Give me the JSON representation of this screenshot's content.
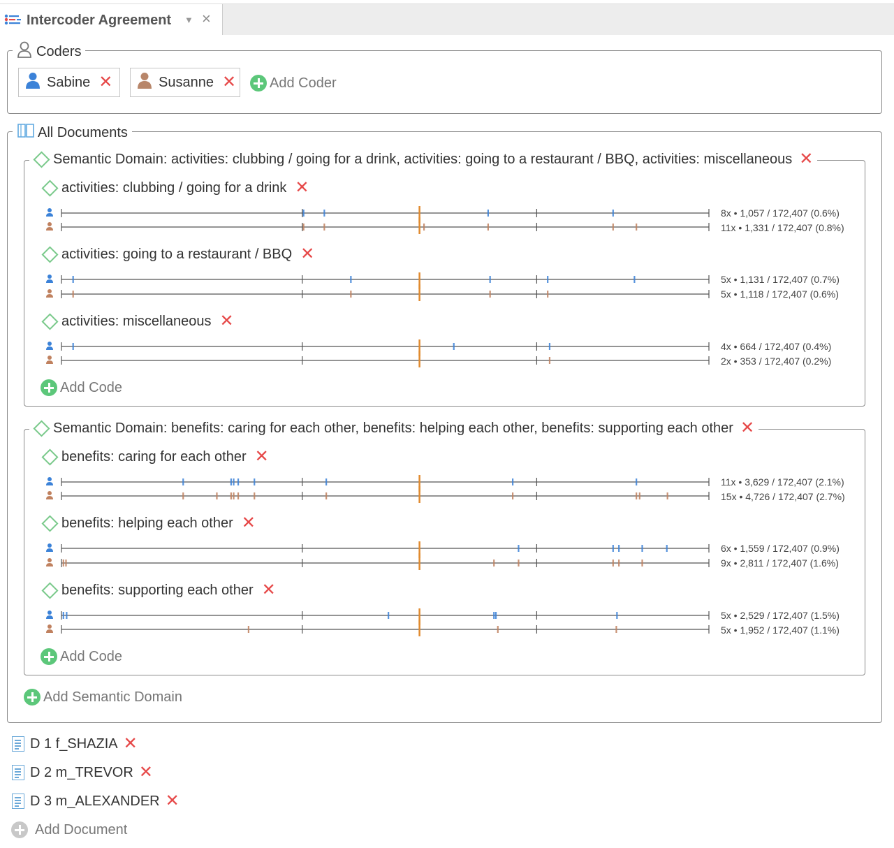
{
  "tab": {
    "title": "Intercoder Agreement",
    "dropdown_icon": "chevron-down-icon",
    "close_symbol": "×"
  },
  "colors": {
    "coder1": "#3b82d8",
    "coder2": "#c0815f",
    "remove": "#e64848",
    "add": "#5cc77a",
    "marker": "#e08a2e",
    "diamond": "#79c98a"
  },
  "coders": {
    "legend": "Coders",
    "items": [
      {
        "name": "Sabine",
        "color": "#3b82d8"
      },
      {
        "name": "Susanne",
        "color": "#b8866a"
      }
    ],
    "add_label": "Add Coder"
  },
  "documents_group": {
    "legend": "All Documents"
  },
  "domains": [
    {
      "title": "Semantic Domain: activities: clubbing / going for a drink, activities: going to a restaurant / BBQ, activities: miscellaneous",
      "codes": [
        {
          "name": "activities: clubbing / going for a drink",
          "rows": [
            {
              "coder": "Sabine",
              "stats": "8x • 1,057 / 172,407 (0.6%)",
              "segments": [
                0.374,
                0.406,
                0.659,
                0.852
              ]
            },
            {
              "coder": "Susanne",
              "stats": "11x • 1,331 / 172,407 (0.8%)",
              "segments": [
                0.374,
                0.406,
                0.56,
                0.659,
                0.852,
                0.888
              ]
            }
          ]
        },
        {
          "name": "activities: going to a restaurant / BBQ",
          "rows": [
            {
              "coder": "Sabine",
              "stats": "5x • 1,131 / 172,407 (0.7%)",
              "segments": [
                0.018,
                0.447,
                0.662,
                0.751,
                0.885
              ]
            },
            {
              "coder": "Susanne",
              "stats": "5x • 1,118 / 172,407 (0.6%)",
              "segments": [
                0.018,
                0.447,
                0.662,
                0.751
              ]
            }
          ]
        },
        {
          "name": "activities: miscellaneous",
          "rows": [
            {
              "coder": "Sabine",
              "stats": "4x • 664 / 172,407 (0.4%)",
              "segments": [
                0.018,
                0.606,
                0.754
              ]
            },
            {
              "coder": "Susanne",
              "stats": "2x • 353 / 172,407 (0.2%)",
              "segments": [
                0.754
              ]
            }
          ]
        }
      ],
      "add_code_label": "Add Code"
    },
    {
      "title": "Semantic Domain: benefits: caring for each other, benefits: helping each other, benefits: supporting each other",
      "codes": [
        {
          "name": "benefits: caring for each other",
          "rows": [
            {
              "coder": "Sabine",
              "stats": "11x • 3,629 / 172,407 (2.1%)",
              "segments": [
                0.188,
                0.262,
                0.266,
                0.273,
                0.298,
                0.409,
                0.697,
                0.888
              ]
            },
            {
              "coder": "Susanne",
              "stats": "15x • 4,726 / 172,407 (2.7%)",
              "segments": [
                0.188,
                0.24,
                0.262,
                0.266,
                0.273,
                0.298,
                0.409,
                0.697,
                0.888,
                0.893,
                0.936
              ]
            }
          ]
        },
        {
          "name": "benefits: helping each other",
          "rows": [
            {
              "coder": "Sabine",
              "stats": "6x • 1,559 / 172,407 (0.9%)",
              "segments": [
                0.706,
                0.852,
                0.861,
                0.897,
                0.935
              ]
            },
            {
              "coder": "Susanne",
              "stats": "9x • 2,811 / 172,407 (1.6%)",
              "segments": [
                0.003,
                0.007,
                0.668,
                0.706,
                0.852,
                0.861,
                0.897
              ]
            }
          ]
        },
        {
          "name": "benefits: supporting each other",
          "rows": [
            {
              "coder": "Sabine",
              "stats": "5x • 2,529 / 172,407 (1.5%)",
              "segments": [
                0.003,
                0.008,
                0.505,
                0.668,
                0.671,
                0.858
              ]
            },
            {
              "coder": "Susanne",
              "stats": "5x • 1,952 / 172,407 (1.1%)",
              "segments": [
                0.289,
                0.674,
                0.857
              ]
            }
          ]
        }
      ],
      "add_code_label": "Add Code"
    }
  ],
  "add_domain_label": "Add Semantic Domain",
  "documents": [
    {
      "name": "D 1 f_SHAZIA"
    },
    {
      "name": "D 2 m_TREVOR"
    },
    {
      "name": "D 3 m_ALEXANDER"
    }
  ],
  "add_document_label": "Add Document",
  "remove_symbol": "✕",
  "track": {
    "major_ticks": [
      0.372,
      0.734
    ],
    "center_marker": 0.553
  }
}
